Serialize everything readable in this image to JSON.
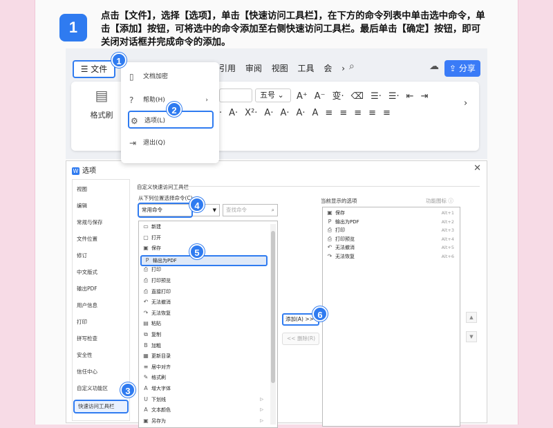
{
  "step": {
    "number": "1",
    "text": "点击【文件】，选择【选项】，单击【快速访问工具栏】，在下方的命令列表中单击选中命令，单击【添加】按钮，可将选中的命令添加至右侧快速访问工具栏。最后单击【确定】按钮，即可关闭对话框并完成命令的添加。"
  },
  "ribbon": {
    "file_button": "☰ 文件",
    "tabs": [
      "引用",
      "审阅",
      "视图",
      "工具",
      "会"
    ],
    "share": "分享",
    "format_painter": "格式刷",
    "font_size": "五号",
    "row1": [
      "A⁺",
      "A⁻",
      "变·",
      "⌫",
      "☰·",
      "☰·",
      "⇤",
      "⇥"
    ],
    "row2": [
      "·",
      "A·",
      "X²·",
      "A·",
      "A·",
      "A·",
      "A",
      "≡",
      "≡",
      "≡",
      "≡",
      "≡"
    ]
  },
  "file_menu": {
    "items": [
      {
        "label": "文档加密",
        "icon": "document-lock-icon"
      },
      {
        "label": "帮助(H)",
        "icon": "help-icon"
      },
      {
        "label": "选项(L)",
        "icon": "settings-icon"
      },
      {
        "label": "退出(Q)",
        "icon": "exit-icon"
      }
    ]
  },
  "badges": [
    "1",
    "2",
    "3",
    "4",
    "5",
    "6"
  ],
  "dialog": {
    "title": "选项",
    "nav": [
      "视图",
      "编辑",
      "常规与保存",
      "文件位置",
      "修订",
      "中文版式",
      "输出PDF",
      "用户信息",
      "打印",
      "拼写检查",
      "安全性",
      "信任中心",
      "自定义功能区",
      "快速访问工具栏"
    ],
    "section_title": "自定义快速访问工具栏",
    "choose_from_label": "从下列位置选择命令(C):",
    "combo_value": "常用命令",
    "search_placeholder": "查找命令",
    "commands": [
      {
        "label": "新建",
        "icon": "▭"
      },
      {
        "label": "打开",
        "icon": "▢"
      },
      {
        "label": "保存",
        "icon": "▣"
      },
      {
        "label": "输出为PDF",
        "icon": "P"
      },
      {
        "label": "打印",
        "icon": "⎙"
      },
      {
        "label": "打印预览",
        "icon": "⎙"
      },
      {
        "label": "直接打印",
        "icon": "⎙"
      },
      {
        "label": "无法撤消",
        "icon": "↶"
      },
      {
        "label": "无法恢复",
        "icon": "↷"
      },
      {
        "label": "粘贴",
        "icon": "▤"
      },
      {
        "label": "复制",
        "icon": "⧉"
      },
      {
        "label": "加粗",
        "icon": "B"
      },
      {
        "label": "更新目录",
        "icon": "▦"
      },
      {
        "label": "居中对齐",
        "icon": "≡"
      },
      {
        "label": "格式刷",
        "icon": "✎"
      },
      {
        "label": "增大字体",
        "icon": "A"
      },
      {
        "label": "下划线",
        "icon": "U"
      },
      {
        "label": "文本颜色",
        "icon": "A"
      },
      {
        "label": "另存为",
        "icon": "▣"
      }
    ],
    "add_button": "添加(A) >>",
    "remove_button": "<< 删除(R)",
    "right_label": "当前显示的选项",
    "right_hint": "功能图标 ⓘ",
    "current": [
      {
        "label": "保存",
        "icon": "▣",
        "key": "Alt+1"
      },
      {
        "label": "输出为PDF",
        "icon": "P",
        "key": "Alt+2"
      },
      {
        "label": "打印",
        "icon": "⎙",
        "key": "Alt+3"
      },
      {
        "label": "打印预览",
        "icon": "⎙",
        "key": "Alt+4"
      },
      {
        "label": "无法撤消",
        "icon": "↶",
        "key": "Alt+5"
      },
      {
        "label": "无法恢复",
        "icon": "↷",
        "key": "Alt+6"
      }
    ]
  }
}
